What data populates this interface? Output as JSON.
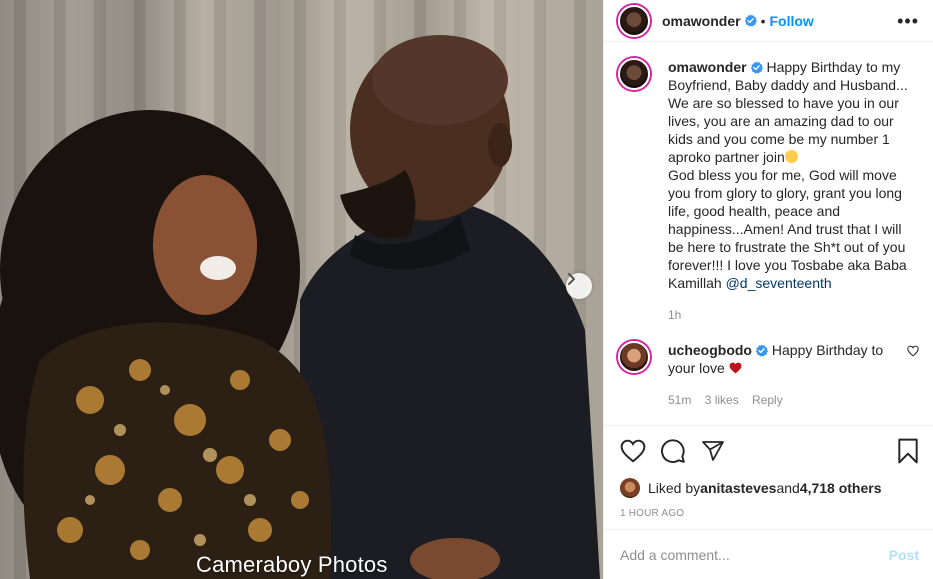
{
  "photo": {
    "watermark": "Cameraboy Photos"
  },
  "header": {
    "username": "omawonder",
    "separator": "•",
    "follow_label": "Follow",
    "more_label": "•••"
  },
  "caption": {
    "username": "omawonder",
    "text_1": " Happy Birthday to my Boyfriend, Baby daddy and Husband... We are so blessed to have you in our lives, you are an amazing dad to our kids and you come be my number 1 aproko partner join",
    "text_2": "God bless you for me, God will move you from glory to glory, grant you long life, good health, peace and happiness...Amen! And trust that I will be here to frustrate the Sh*t out of you forever!!! I love you Tosbabe aka Baba Kamillah ",
    "mention": "@d_seventeenth",
    "time": "1h"
  },
  "comment": {
    "username": "ucheogbodo",
    "text": " Happy Birthday to your love ",
    "time": "51m",
    "likes": "3 likes",
    "reply_label": "Reply"
  },
  "likes": {
    "prefix": "Liked by ",
    "user": "anitasteves",
    "middle": " and ",
    "count": "4,718 others"
  },
  "time_ago": "1 HOUR AGO",
  "add_comment": {
    "placeholder": "Add a comment...",
    "post_label": "Post"
  },
  "colors": {
    "accent": "#0095f6",
    "verified": "#3897f0",
    "heart": "#c0141c",
    "post_disabled": "#b2dffc"
  },
  "icons": [
    "chevron-right-icon",
    "verified-badge-icon",
    "more-icon",
    "heart-icon",
    "comment-icon",
    "share-icon",
    "bookmark-icon",
    "small-heart-icon",
    "emoji-icon"
  ]
}
